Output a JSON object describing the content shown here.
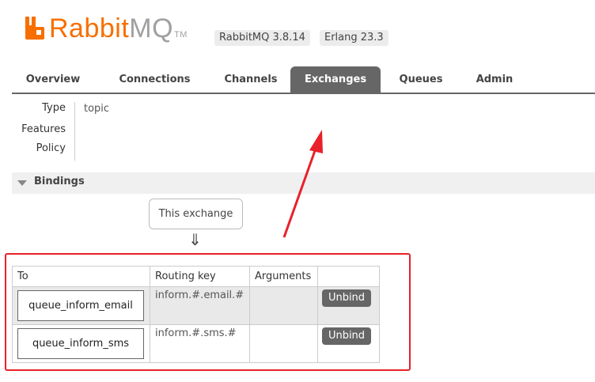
{
  "header": {
    "logo_rabbit": "Rabbit",
    "logo_mq": "MQ",
    "logo_tm": "TM",
    "rabbitmq_version": "RabbitMQ 3.8.14",
    "erlang_version": "Erlang 23.3"
  },
  "tabs": [
    {
      "label": "Overview",
      "active": false
    },
    {
      "label": "Connections",
      "active": false
    },
    {
      "label": "Channels",
      "active": false
    },
    {
      "label": "Exchanges",
      "active": true
    },
    {
      "label": "Queues",
      "active": false
    },
    {
      "label": "Admin",
      "active": false
    }
  ],
  "details": {
    "type_label": "Type",
    "type_value": "topic",
    "features_label": "Features",
    "policy_label": "Policy"
  },
  "bindings": {
    "title": "Bindings",
    "this_exchange": "This exchange",
    "down_arrow": "⇓",
    "columns": {
      "to": "To",
      "routing_key": "Routing key",
      "arguments": "Arguments"
    },
    "rows": [
      {
        "to": "queue_inform_email",
        "routing_key": "inform.#.email.#",
        "arguments": "",
        "action": "Unbind"
      },
      {
        "to": "queue_inform_sms",
        "routing_key": "inform.#.sms.#",
        "arguments": "",
        "action": "Unbind"
      }
    ]
  },
  "colors": {
    "brand_orange": "#f76f00",
    "tab_active": "#666666",
    "annotation_red": "#e8212a"
  }
}
